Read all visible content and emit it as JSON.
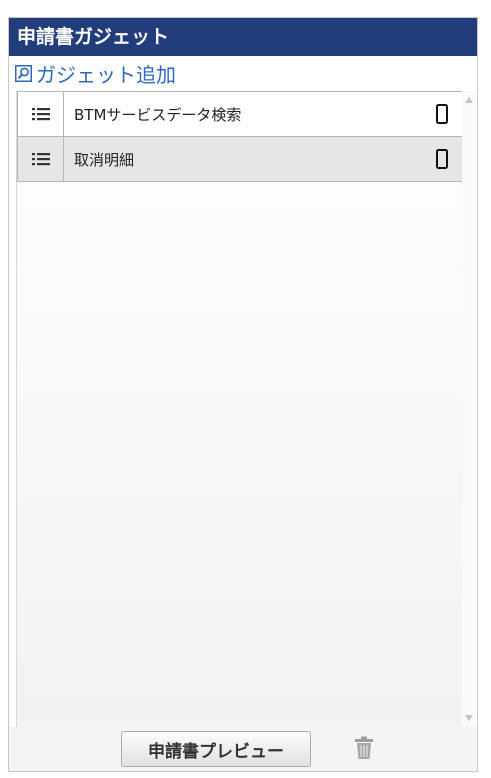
{
  "panel": {
    "title": "申請書ガジェット",
    "add_link_label": "ガジェット追加",
    "add_icon": "search-icon"
  },
  "gadgets": [
    {
      "label": "BTMサービスデータ検索",
      "handle_icon": "list-icon",
      "device_icon": "smartphone-icon"
    },
    {
      "label": "取消明細",
      "handle_icon": "list-icon",
      "device_icon": "smartphone-icon"
    }
  ],
  "footer": {
    "preview_label": "申請書プレビュー",
    "trash_icon": "trash-icon"
  },
  "colors": {
    "header_bg": "#213d7c",
    "link": "#2e68c0"
  }
}
